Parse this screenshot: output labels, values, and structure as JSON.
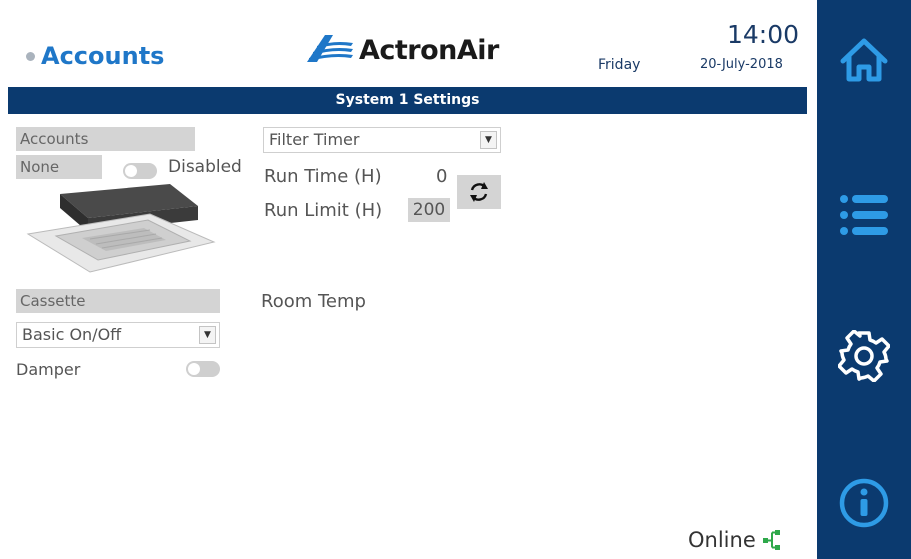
{
  "header": {
    "title": "Accounts",
    "brand": "ActronAir",
    "day": "Friday",
    "time": "14:00",
    "date": "20-July-2018"
  },
  "banner": {
    "title": "System 1 Settings"
  },
  "left_panel": {
    "accounts_label": "Accounts",
    "account_value": "None",
    "account_toggle_label": "Disabled",
    "unit_type_label": "Cassette",
    "mode_select": "Basic On/Off",
    "damper_label": "Damper"
  },
  "filter": {
    "select_value": "Filter Timer",
    "run_time_label": "Run Time (H)",
    "run_time_value": "0",
    "run_limit_label": "Run Limit (H)",
    "run_limit_value": "200"
  },
  "room_temp": {
    "label": "Room Temp"
  },
  "status": {
    "online_label": "Online"
  },
  "nav": {
    "items": [
      {
        "name": "home",
        "icon": "home-icon"
      },
      {
        "name": "menu",
        "icon": "list-icon"
      },
      {
        "name": "settings",
        "icon": "gear-icon"
      },
      {
        "name": "info",
        "icon": "info-icon"
      }
    ]
  },
  "colors": {
    "navy": "#0b3a6f",
    "accent_blue": "#1f77c8",
    "icon_blue": "#2e9be6",
    "online_green": "#2ea84a",
    "panel_grey": "#d4d4d4"
  }
}
